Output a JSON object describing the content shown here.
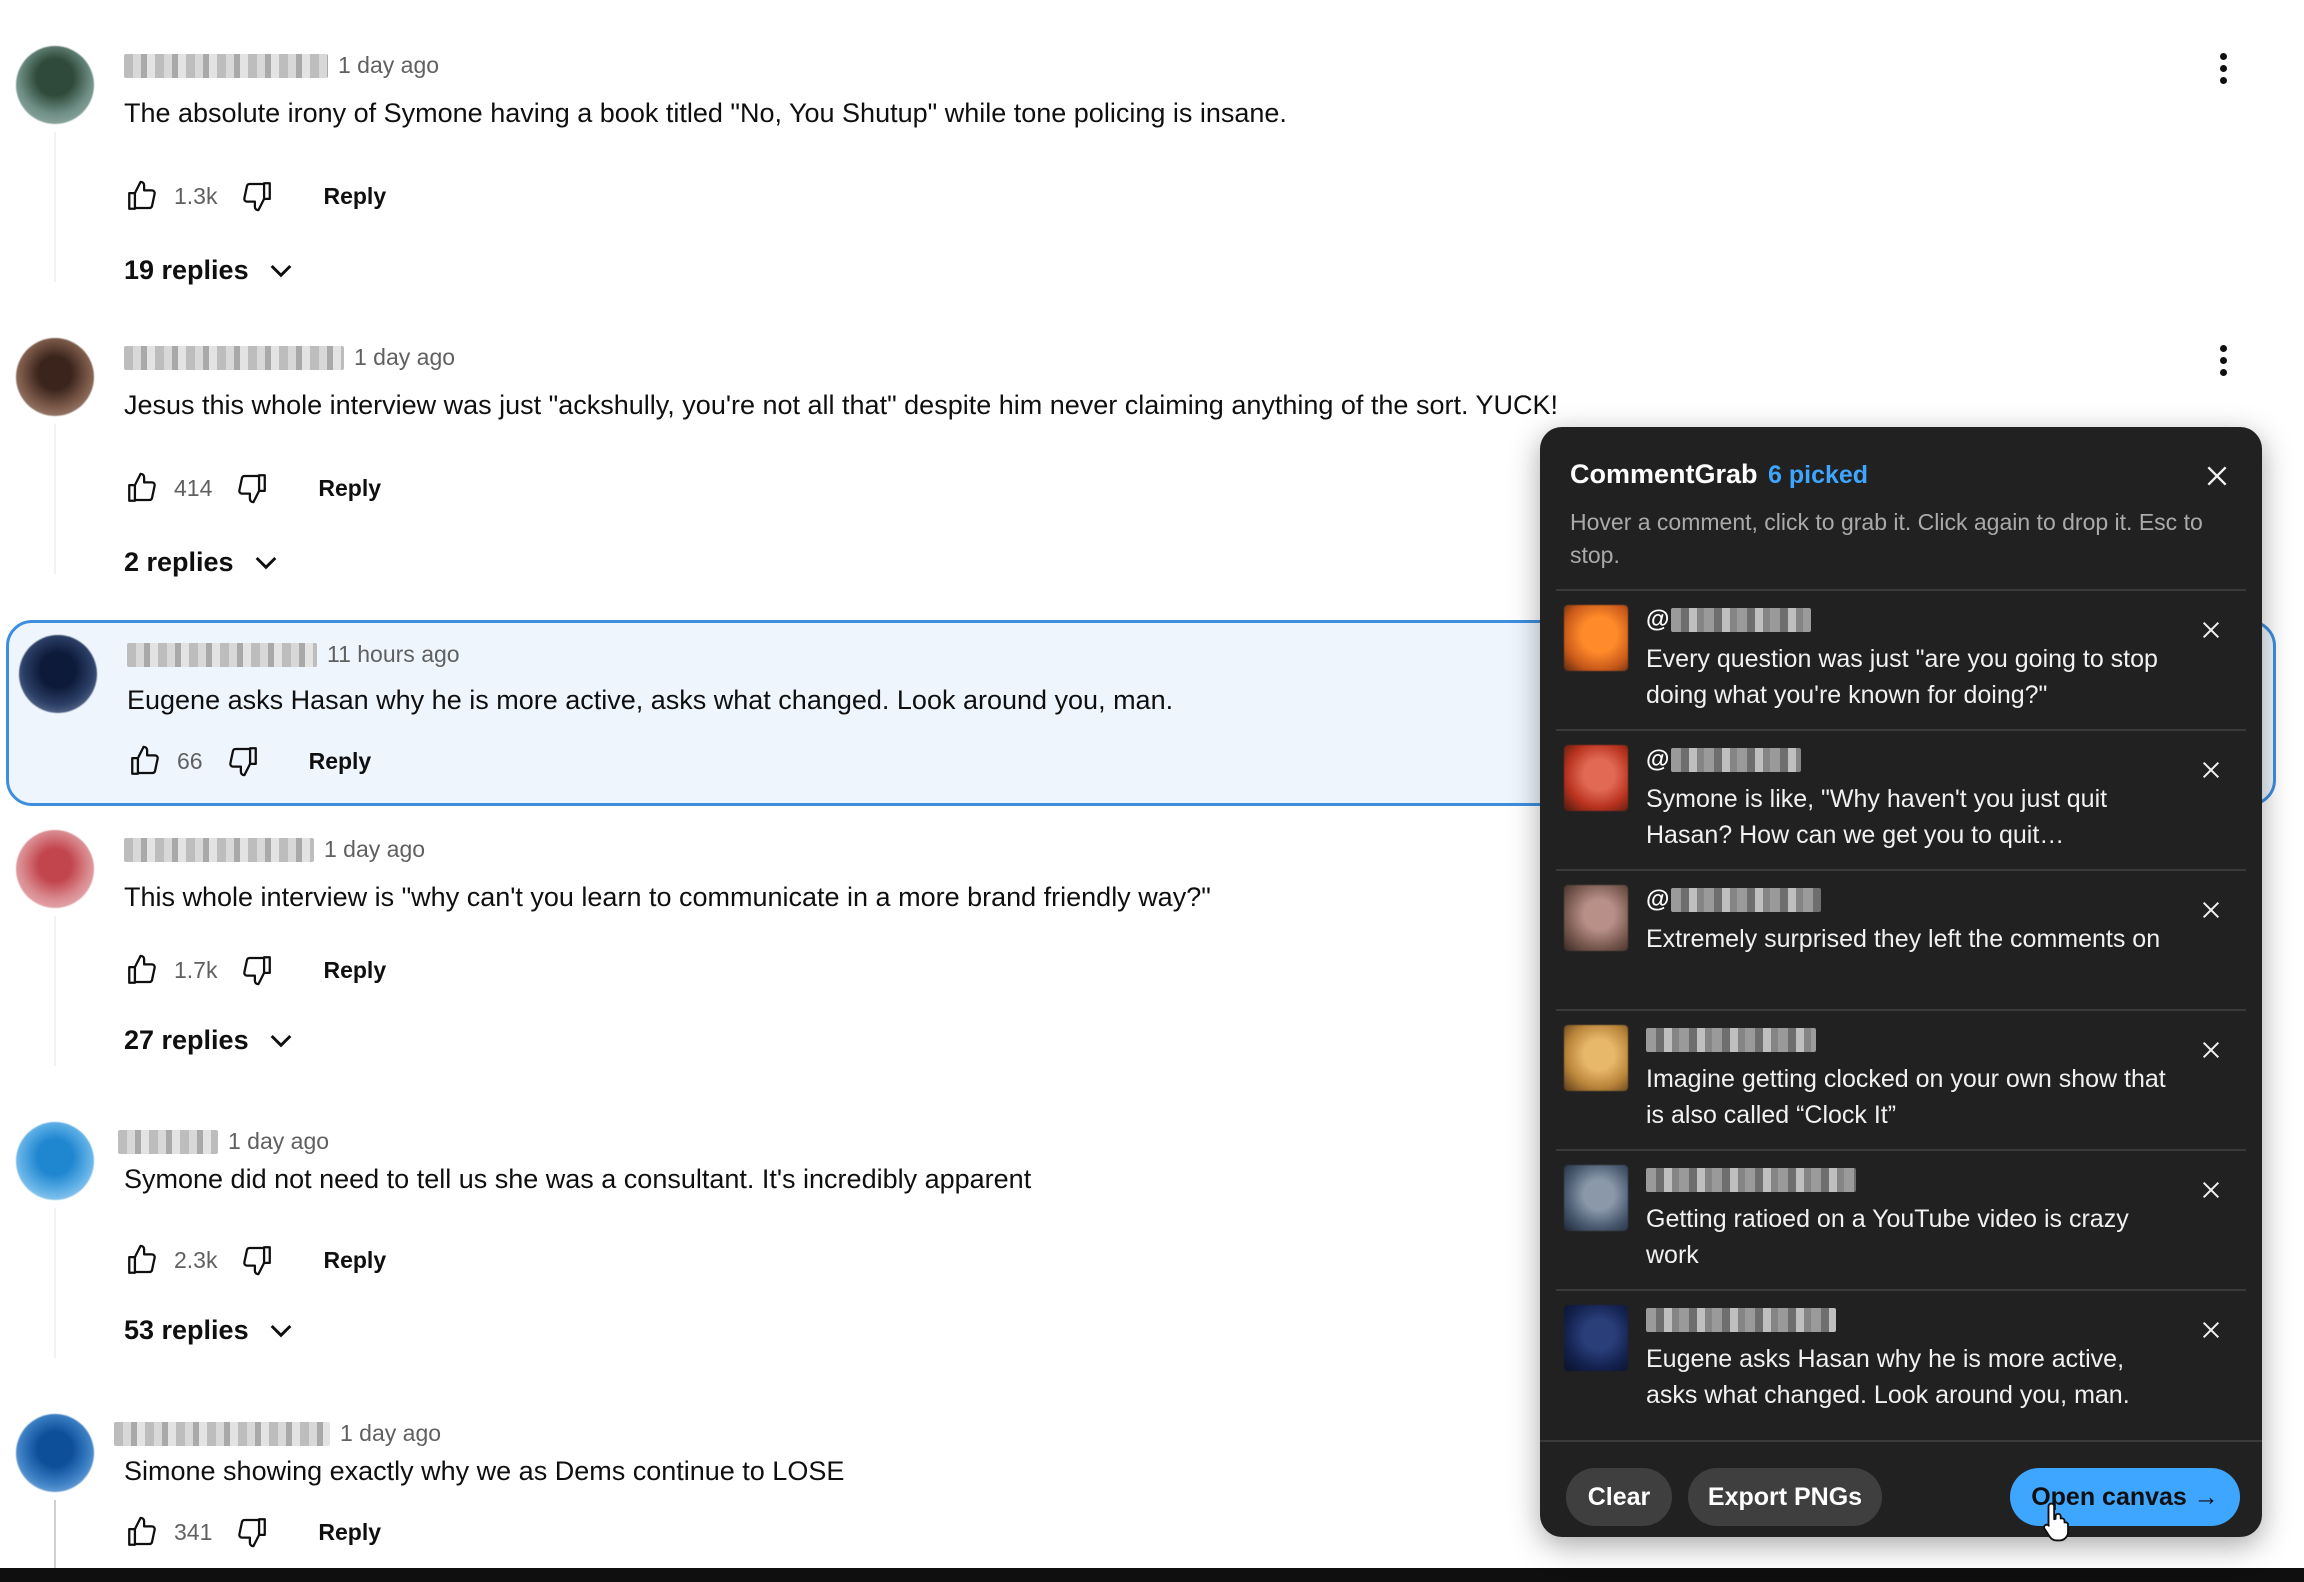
{
  "comments": [
    {
      "time": "1 day ago",
      "text": "The absolute irony of Symone having a book titled \"No, You Shutup\" while  tone policing is insane.",
      "likes": "1.3k",
      "reply_label": "Reply",
      "replies": "19 replies",
      "avatar_color": "#4f6f63"
    },
    {
      "time": "1 day ago",
      "text": "Jesus this whole interview was just \"ackshully, you're not all that\" despite him never claiming anything of the sort. YUCK!",
      "likes": "414",
      "reply_label": "Reply",
      "replies": "2 replies",
      "avatar_color": "#6b4a3c"
    },
    {
      "time": "11 hours ago",
      "text": "Eugene asks Hasan why he is more active, asks what changed. Look around you, man.",
      "likes": "66",
      "reply_label": "Reply",
      "replies": "",
      "avatar_color": "#1e2f55"
    },
    {
      "time": "1 day ago",
      "text": "This whole interview is \"why can't you learn to communicate in a more brand friendly way?\"",
      "likes": "1.7k",
      "reply_label": "Reply",
      "replies": "27 replies",
      "avatar_color": "#d27a80"
    },
    {
      "time": "1 day ago",
      "text": "Symone did not need to tell us she was a consultant. It's incredibly apparent",
      "likes": "2.3k",
      "reply_label": "Reply",
      "replies": "53 replies",
      "avatar_color": "#3e9ad8"
    },
    {
      "time": "1 day ago",
      "text": "Simone showing exactly why we as Dems continue to LOSE",
      "likes": "341",
      "reply_label": "Reply",
      "replies": "",
      "avatar_color": "#2c6fb0"
    }
  ],
  "panel": {
    "title": "CommentGrab",
    "picked": "6 picked",
    "hint": "Hover a comment, click to grab it. Click again to drop it. Esc to stop.",
    "items": [
      {
        "handle_prefix": "@",
        "handle_visible": "y  g",
        "text": "Every question was just \"are you going to stop doing what you're known for doing?\"",
        "thumb_color": "#e06a1a"
      },
      {
        "handle_prefix": "@",
        "handle_visible": "",
        "text": "Symone is like, \"Why haven't you just quit Hasan? How can we get you to quit…",
        "thumb_color": "#c2402a"
      },
      {
        "handle_prefix": "@",
        "handle_visible": "",
        "text": "Extremely surprised they left the comments on",
        "thumb_color": "#8a6a60"
      },
      {
        "handle_prefix": "",
        "handle_visible": "",
        "text": "Imagine getting clocked on your own show that is also called “Clock It”",
        "thumb_color": "#c8953c"
      },
      {
        "handle_prefix": "",
        "handle_visible": "",
        "text": "Getting ratioed on a YouTube video is crazy work",
        "thumb_color": "#5a6a80"
      },
      {
        "handle_prefix": "",
        "handle_visible": "",
        "text": "Eugene asks Hasan why he is more active, asks what changed. Look around you, man.",
        "thumb_color": "#1c2c5c"
      }
    ],
    "clear_label": "Clear",
    "export_label": "Export PNGs",
    "open_label": "Open canvas →"
  },
  "colors": {
    "accent": "#3ea6ff",
    "highlight_border": "#3e8edf",
    "panel_bg": "#212121"
  }
}
